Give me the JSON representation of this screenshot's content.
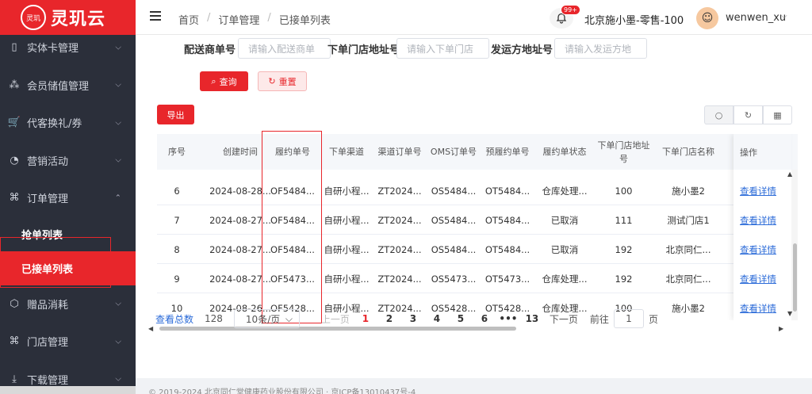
{
  "app": {
    "name": "灵玑云",
    "seal_text": "灵玑"
  },
  "sidebar": {
    "items": [
      {
        "label": "实体卡管理",
        "icon": "card-icon",
        "glyph": "▯",
        "has_chevron": true,
        "chevron": "⌵"
      },
      {
        "label": "会员储值管理",
        "icon": "members-icon",
        "glyph": "⁂",
        "has_chevron": true,
        "chevron": "⌵"
      },
      {
        "label": "代客换礼/券",
        "icon": "cart-icon",
        "glyph": "🛒",
        "has_chevron": true,
        "chevron": "⌵"
      },
      {
        "label": "营销活动",
        "icon": "marketing-icon",
        "glyph": "◔",
        "has_chevron": true,
        "chevron": "⌵"
      },
      {
        "label": "订单管理",
        "icon": "grid-icon",
        "glyph": "⌘",
        "has_chevron": true,
        "chevron": "⌃"
      }
    ],
    "sub_items": [
      {
        "label": "抢单列表",
        "active": false
      },
      {
        "label": "已接单列表",
        "active": true
      }
    ],
    "items_after": [
      {
        "label": "赠品消耗",
        "icon": "cube-icon",
        "glyph": "⬡",
        "chevron": "⌵"
      },
      {
        "label": "门店管理",
        "icon": "grid-icon",
        "glyph": "⌘",
        "chevron": "⌵"
      },
      {
        "label": "下载管理",
        "icon": "download-icon",
        "glyph": "⤓",
        "chevron": "⌵"
      }
    ]
  },
  "header": {
    "breadcrumb": [
      "首页",
      "订单管理",
      "已接单列表"
    ],
    "breadcrumb_sep": "/",
    "notification_badge": "99+",
    "store_name": "北京施小墨-零售-100",
    "username": "wenwen_xu",
    "user_chevron": "⌵"
  },
  "filters": [
    {
      "label": "配送商单号",
      "placeholder": "请输入配送商单"
    },
    {
      "label": "下单门店地址号",
      "placeholder": "请输入下单门店"
    },
    {
      "label": "发运方地址号",
      "placeholder": "请输入发运方地"
    }
  ],
  "buttons": {
    "query": "查询",
    "reset": "重置",
    "export": "导出",
    "query_icon": "⌕",
    "reset_icon": "↻"
  },
  "toolbar_icons": [
    {
      "name": "search-toggle-icon",
      "glyph": "○"
    },
    {
      "name": "refresh-icon",
      "glyph": "↻"
    },
    {
      "name": "columns-icon",
      "glyph": "▦"
    }
  ],
  "table": {
    "columns": [
      "序号",
      "创建时间",
      "履约单号",
      "下单渠道",
      "渠道订单号",
      "OMS订单号",
      "预履约单号",
      "履约单状态",
      "下单门店地址号",
      "下单门店名称"
    ],
    "action_column": "操作",
    "rows": [
      [
        "6",
        "2024-08-28...",
        "OF5484...",
        "自研小程...",
        "ZT2024...",
        "OS5484...",
        "OT5484...",
        "仓库处理...",
        "100",
        "施小墨2"
      ],
      [
        "7",
        "2024-08-27...",
        "OF5484...",
        "自研小程...",
        "ZT2024...",
        "OS5484...",
        "OT5484...",
        "已取消",
        "111",
        "测试门店1"
      ],
      [
        "8",
        "2024-08-27...",
        "OF5484...",
        "自研小程...",
        "ZT2024...",
        "OS5484...",
        "OT5484...",
        "已取消",
        "192",
        "北京同仁..."
      ],
      [
        "9",
        "2024-08-27...",
        "OF5473...",
        "自研小程...",
        "ZT2024...",
        "OS5473...",
        "OT5473...",
        "仓库处理...",
        "192",
        "北京同仁..."
      ],
      [
        "10",
        "2024-08-26...",
        "OF5428...",
        "自研小程...",
        "ZT2024...",
        "OS5428...",
        "OT5428...",
        "仓库处理...",
        "100",
        "施小墨2"
      ]
    ],
    "action_label": "查看详情"
  },
  "pagination": {
    "total_label": "查看总数",
    "total": "128",
    "page_size": "10条/页",
    "prev": "上一页",
    "pages": [
      "1",
      "2",
      "3",
      "4",
      "5",
      "6",
      "•••",
      "13"
    ],
    "current": "1",
    "next": "下一页",
    "jump_label": "前往",
    "jump_value": "1",
    "jump_suffix": "页"
  },
  "footer": "© 2019-2024 北京同仁堂健康药业股份有限公司 · 京ICP备13010437号-4",
  "colors": {
    "brand": "#e8262b",
    "sidebar": "#2b2f3a",
    "link": "#2a6ad8"
  }
}
